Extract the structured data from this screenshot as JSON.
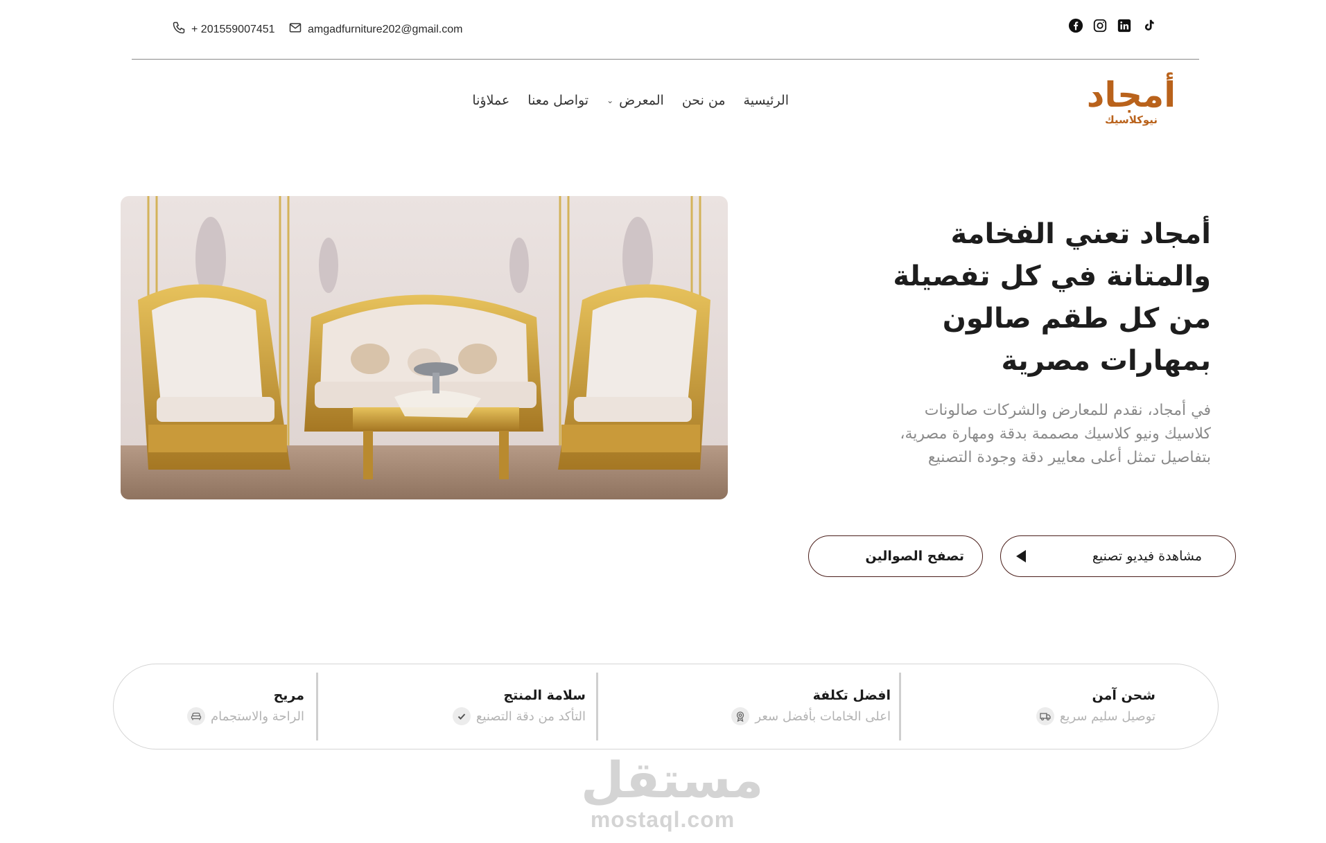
{
  "topbar": {
    "phone": "+ 201559007451",
    "email": "amgadfurniture202@gmail.com",
    "socials": [
      "facebook-icon",
      "instagram-icon",
      "linkedin-icon",
      "tiktok-icon"
    ]
  },
  "logo": {
    "main_text": "أمجاد",
    "sub_text": "نيوكلاسيك",
    "color": "#b9621b"
  },
  "nav": {
    "items": [
      {
        "label": "الرئيسية"
      },
      {
        "label": "من نحن"
      },
      {
        "label": "المعرض",
        "has_dropdown": true
      },
      {
        "label": "تواصل معنا"
      },
      {
        "label": "عملاؤنا"
      }
    ]
  },
  "hero": {
    "title": "أمجاد تعني الفخامة والمتانة في كل تفصيلة من كل طقم صالون بمهارات مصرية",
    "description": "في أمجاد، نقدم للمعارض والشركات صالونات كلاسيك ونيو كلاسيك مصممة بدقة ومهارة مصرية، بتفاصيل تمثل أعلى معايير دقة وجودة التصنيع",
    "video_button": "مشاهدة فيديو تصنيع",
    "browse_button": "تصفح الصوالين",
    "button_border_color": "#4a1e1a"
  },
  "features": [
    {
      "title": "شحن آمن",
      "subtitle": "توصيل سليم سريع",
      "icon": "truck-icon"
    },
    {
      "title": "افضل تكلفة",
      "subtitle": "اعلى الخامات بأفضل سعر",
      "icon": "badge-icon"
    },
    {
      "title": "سلامة المنتج",
      "subtitle": "التأكد من دقة التصنيع",
      "icon": "check-icon"
    },
    {
      "title": "مريح",
      "subtitle": "الراحة والاستجمام",
      "icon": "sofa-icon"
    }
  ],
  "watermark": {
    "arabic": "مستقل",
    "latin": "mostaql.com"
  }
}
